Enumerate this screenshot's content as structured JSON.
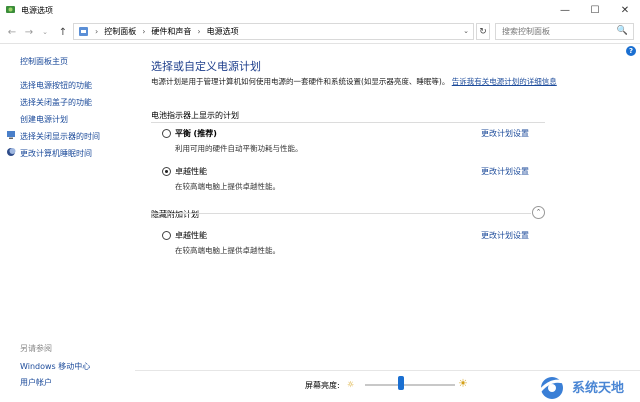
{
  "window": {
    "title": "电源选项",
    "minimize_glyph": "—",
    "maximize_glyph": "☐",
    "close_glyph": "✕"
  },
  "nav": {
    "back_glyph": "←",
    "forward_glyph": "→",
    "dropdown_glyph": "⌄",
    "up_glyph": "↑",
    "breadcrumbs": [
      "控制面板",
      "硬件和声音",
      "电源选项"
    ],
    "separator": "›",
    "refresh_glyph": "↻",
    "search_placeholder": "搜索控制面板",
    "search_icon_glyph": "🔍"
  },
  "help_glyph": "?",
  "sidebar": {
    "home": "控制面板主页",
    "links": [
      "选择电源按钮的功能",
      "选择关闭盖子的功能",
      "创建电源计划",
      "选择关闭显示器的时间",
      "更改计算机睡眠时间"
    ],
    "see_also_title": "另请参阅",
    "see_also": [
      "Windows 移动中心",
      "用户帐户"
    ]
  },
  "main": {
    "heading": "选择或自定义电源计划",
    "description": "电源计划是用于管理计算机如何使用电源的一套硬件和系统设置(如显示器亮度、睡眠等)。",
    "description_link": "告诉我有关电源计划的详细信息",
    "battery_section": "电池指示器上显示的计划",
    "plans": [
      {
        "name": "平衡",
        "tag": "(推荐)",
        "desc": "利用可用的硬件自动平衡功耗与性能。",
        "link": "更改计划设置",
        "selected": false
      },
      {
        "name": "卓越性能",
        "tag": "",
        "desc": "在较高端电脑上提供卓越性能。",
        "link": "更改计划设置",
        "selected": true
      }
    ],
    "hidden_section": "隐藏附加计划",
    "collapse_glyph": "⌃",
    "hidden_plans": [
      {
        "name": "卓越性能",
        "desc": "在较高端电脑上提供卓越性能。",
        "link": "更改计划设置",
        "selected": false
      }
    ]
  },
  "brightness": {
    "label": "屏幕亮度:",
    "value_percent": 40,
    "sun_small_glyph": "☼",
    "sun_big_glyph": "☀"
  },
  "watermark": {
    "text": "系统天地"
  }
}
